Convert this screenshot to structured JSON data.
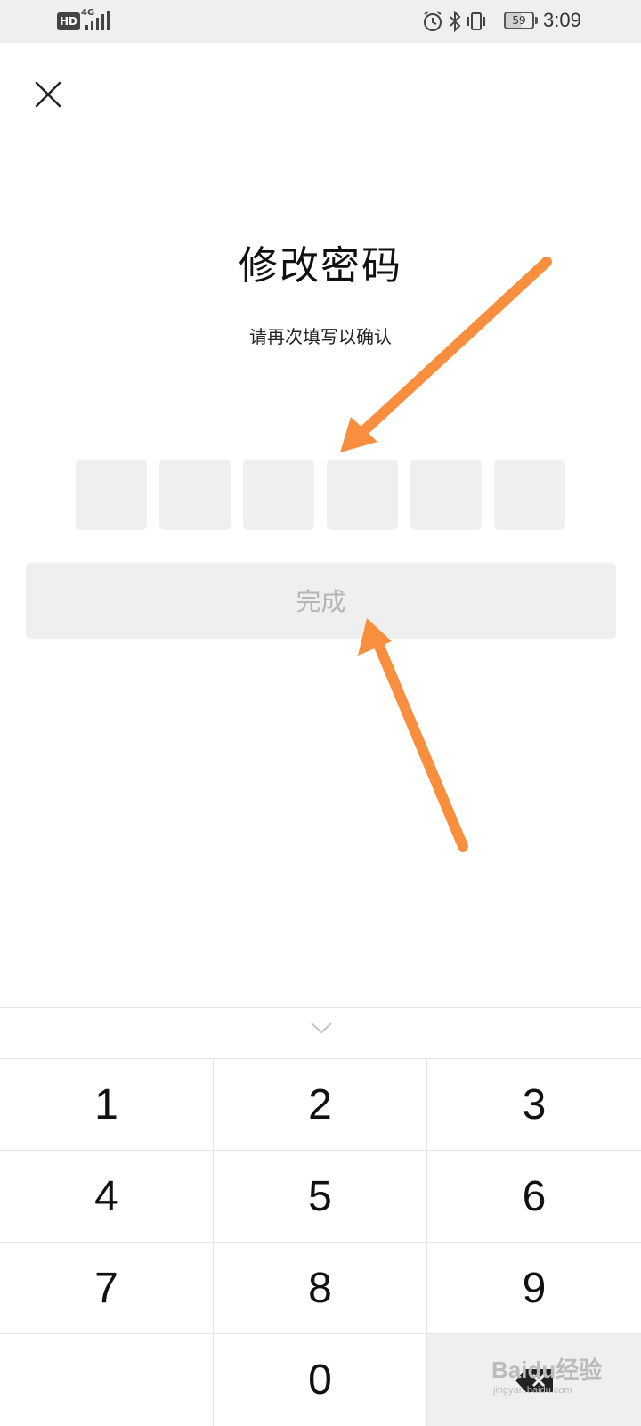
{
  "status_bar": {
    "hd_label": "HD",
    "network_label": "4G",
    "battery_level": "59",
    "time": "3:09"
  },
  "header": {
    "close_icon": "close-icon"
  },
  "main": {
    "title": "修改密码",
    "subtitle": "请再次填写以确认",
    "pin_length": 6,
    "done_label": "完成"
  },
  "keypad": {
    "collapse_icon": "chevron-down-icon",
    "keys": [
      "1",
      "2",
      "3",
      "4",
      "5",
      "6",
      "7",
      "8",
      "9",
      "",
      "0",
      "delete"
    ],
    "delete_icon": "backspace-icon"
  },
  "watermark": {
    "text": "Baidu经验",
    "subtext": "jingyan.baidu.com"
  },
  "colors": {
    "annotation_arrow": "#f98f3e",
    "input_bg": "#efefef",
    "disabled_text": "#b5b5b5"
  }
}
